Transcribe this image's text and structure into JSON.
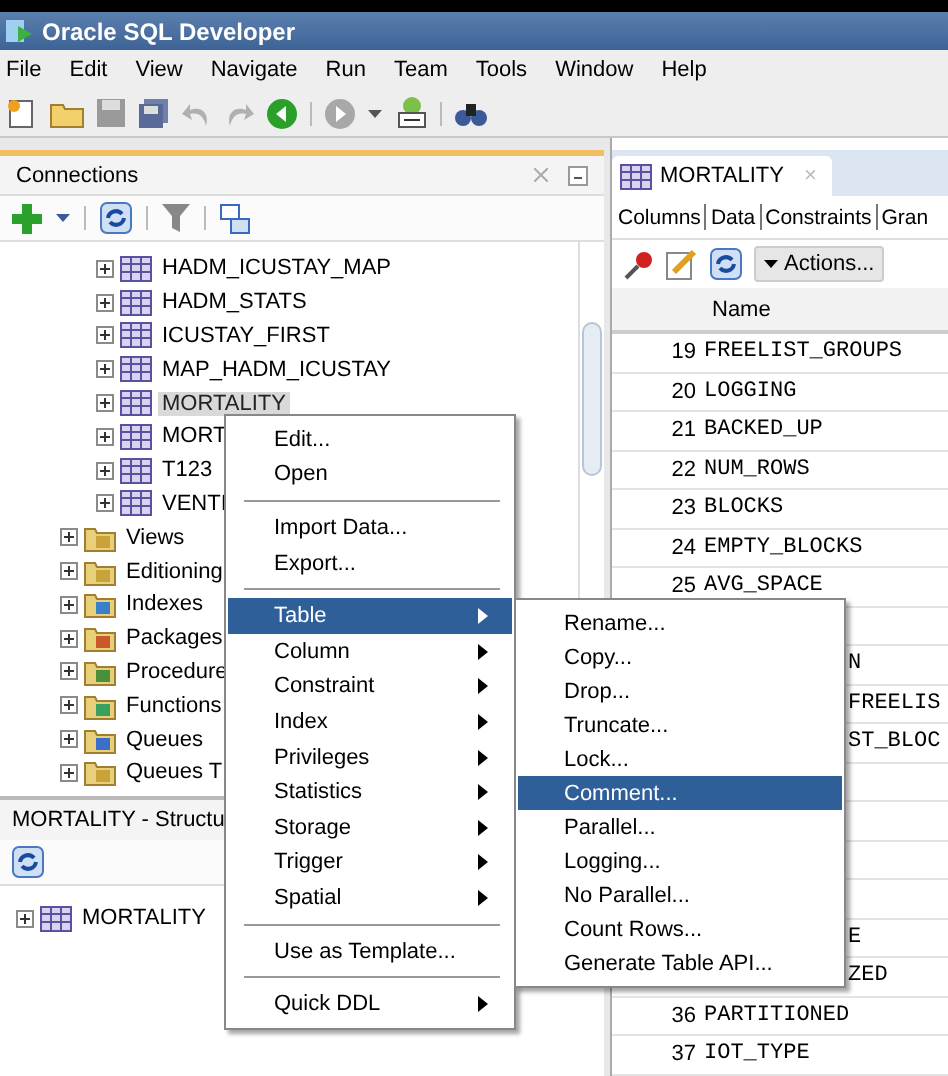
{
  "window": {
    "title": "Oracle SQL Developer"
  },
  "menu_bar": [
    "File",
    "Edit",
    "View",
    "Navigate",
    "Run",
    "Team",
    "Tools",
    "Window",
    "Help"
  ],
  "connections": {
    "title": "Connections",
    "tables": [
      {
        "label": "HADM_ICUSTAY_MAP",
        "selected": false
      },
      {
        "label": "HADM_STATS",
        "selected": false
      },
      {
        "label": "ICUSTAY_FIRST",
        "selected": false
      },
      {
        "label": "MAP_HADM_ICUSTAY",
        "selected": false
      },
      {
        "label": "MORTALITY",
        "selected": true
      },
      {
        "label": "MORT",
        "selected": false
      },
      {
        "label": "T123",
        "selected": false
      },
      {
        "label": "VENTI",
        "selected": false
      }
    ],
    "folders": [
      {
        "label": "Views",
        "kind": "view"
      },
      {
        "label": "Editioning",
        "kind": "view"
      },
      {
        "label": "Indexes",
        "kind": "index"
      },
      {
        "label": "Packages",
        "kind": "package"
      },
      {
        "label": "Procedure",
        "kind": "procedure"
      },
      {
        "label": "Functions",
        "kind": "function"
      },
      {
        "label": "Queues",
        "kind": "queue"
      },
      {
        "label": "Queues T",
        "kind": "view"
      }
    ]
  },
  "structure": {
    "title": "MORTALITY - Structu",
    "tree": [
      {
        "label": "MORTALITY"
      }
    ]
  },
  "editor": {
    "tab": {
      "label": "MORTALITY",
      "close": "×"
    },
    "subtabs": [
      "Columns",
      "Data",
      "Constraints",
      "Gran"
    ],
    "actions_button": "Actions...",
    "table": {
      "columns": [
        "Name"
      ],
      "rows": [
        {
          "kind": "full",
          "number": "19",
          "name": "FREELIST_GROUPS"
        },
        {
          "kind": "full",
          "number": "20",
          "name": "LOGGING"
        },
        {
          "kind": "full",
          "number": "21",
          "name": "BACKED_UP"
        },
        {
          "kind": "full",
          "number": "22",
          "name": "NUM_ROWS"
        },
        {
          "kind": "full",
          "number": "23",
          "name": "BLOCKS"
        },
        {
          "kind": "full",
          "number": "24",
          "name": "EMPTY_BLOCKS"
        },
        {
          "kind": "full",
          "number": "25",
          "name": "AVG_SPACE"
        },
        {
          "kind": "covered"
        },
        {
          "kind": "partial",
          "name": "N"
        },
        {
          "kind": "partial",
          "name": "FREELIS"
        },
        {
          "kind": "partial",
          "name": "ST_BLOC"
        },
        {
          "kind": "covered"
        },
        {
          "kind": "covered"
        },
        {
          "kind": "covered"
        },
        {
          "kind": "covered"
        },
        {
          "kind": "partial",
          "name": "E"
        },
        {
          "kind": "partial",
          "name": "ZED"
        },
        {
          "kind": "full",
          "number": "36",
          "name": "PARTITIONED"
        },
        {
          "kind": "full",
          "number": "37",
          "name": "IOT_TYPE"
        }
      ]
    }
  },
  "context_menu": [
    {
      "kind": "item",
      "label": "Edit...",
      "submenu": false,
      "selected": false
    },
    {
      "kind": "item",
      "label": "Open",
      "submenu": false,
      "selected": false
    },
    {
      "kind": "separator"
    },
    {
      "kind": "item",
      "label": "Import Data...",
      "submenu": false,
      "selected": false
    },
    {
      "kind": "item",
      "label": "Export...",
      "submenu": false,
      "selected": false
    },
    {
      "kind": "separator"
    },
    {
      "kind": "item",
      "label": "Table",
      "submenu": true,
      "selected": true
    },
    {
      "kind": "item",
      "label": "Column",
      "submenu": true,
      "selected": false
    },
    {
      "kind": "item",
      "label": "Constraint",
      "submenu": true,
      "selected": false
    },
    {
      "kind": "item",
      "label": "Index",
      "submenu": true,
      "selected": false
    },
    {
      "kind": "item",
      "label": "Privileges",
      "submenu": true,
      "selected": false
    },
    {
      "kind": "item",
      "label": "Statistics",
      "submenu": true,
      "selected": false
    },
    {
      "kind": "item",
      "label": "Storage",
      "submenu": true,
      "selected": false
    },
    {
      "kind": "item",
      "label": "Trigger",
      "submenu": true,
      "selected": false
    },
    {
      "kind": "item",
      "label": "Spatial",
      "submenu": true,
      "selected": false
    },
    {
      "kind": "separator"
    },
    {
      "kind": "item",
      "label": "Use as Template...",
      "submenu": false,
      "selected": false
    },
    {
      "kind": "separator"
    },
    {
      "kind": "item",
      "label": "Quick DDL",
      "submenu": true,
      "selected": false
    }
  ],
  "submenu": [
    {
      "kind": "item",
      "label": "Rename...",
      "submenu": false,
      "selected": false
    },
    {
      "kind": "item",
      "label": "Copy...",
      "submenu": false,
      "selected": false
    },
    {
      "kind": "item",
      "label": "Drop...",
      "submenu": false,
      "selected": false
    },
    {
      "kind": "item",
      "label": "Truncate...",
      "submenu": false,
      "selected": false
    },
    {
      "kind": "item",
      "label": "Lock...",
      "submenu": false,
      "selected": false
    },
    {
      "kind": "item",
      "label": "Comment...",
      "submenu": false,
      "selected": true
    },
    {
      "kind": "item",
      "label": "Parallel...",
      "submenu": false,
      "selected": false
    },
    {
      "kind": "item",
      "label": "Logging...",
      "submenu": false,
      "selected": false
    },
    {
      "kind": "item",
      "label": "No Parallel...",
      "submenu": false,
      "selected": false
    },
    {
      "kind": "item",
      "label": "Count Rows...",
      "submenu": false,
      "selected": false
    },
    {
      "kind": "item",
      "label": "Generate Table API...",
      "submenu": false,
      "selected": false
    }
  ]
}
